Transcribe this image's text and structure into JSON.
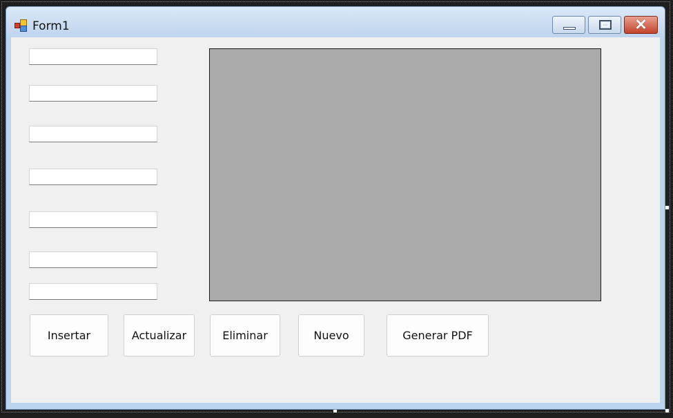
{
  "window": {
    "title": "Form1",
    "icon": "form-app-icon",
    "controls": {
      "minimize": "minimize-icon",
      "maximize": "maximize-icon",
      "close": "close-icon"
    }
  },
  "form": {
    "textboxes": [
      "",
      "",
      "",
      "",
      "",
      "",
      ""
    ],
    "picture_box": {
      "fill_color": "#aaaaaa"
    },
    "buttons": {
      "insert": "Insertar",
      "update": "Actualizar",
      "delete": "Eliminar",
      "new": "Nuevo",
      "pdf": "Generar PDF"
    }
  }
}
